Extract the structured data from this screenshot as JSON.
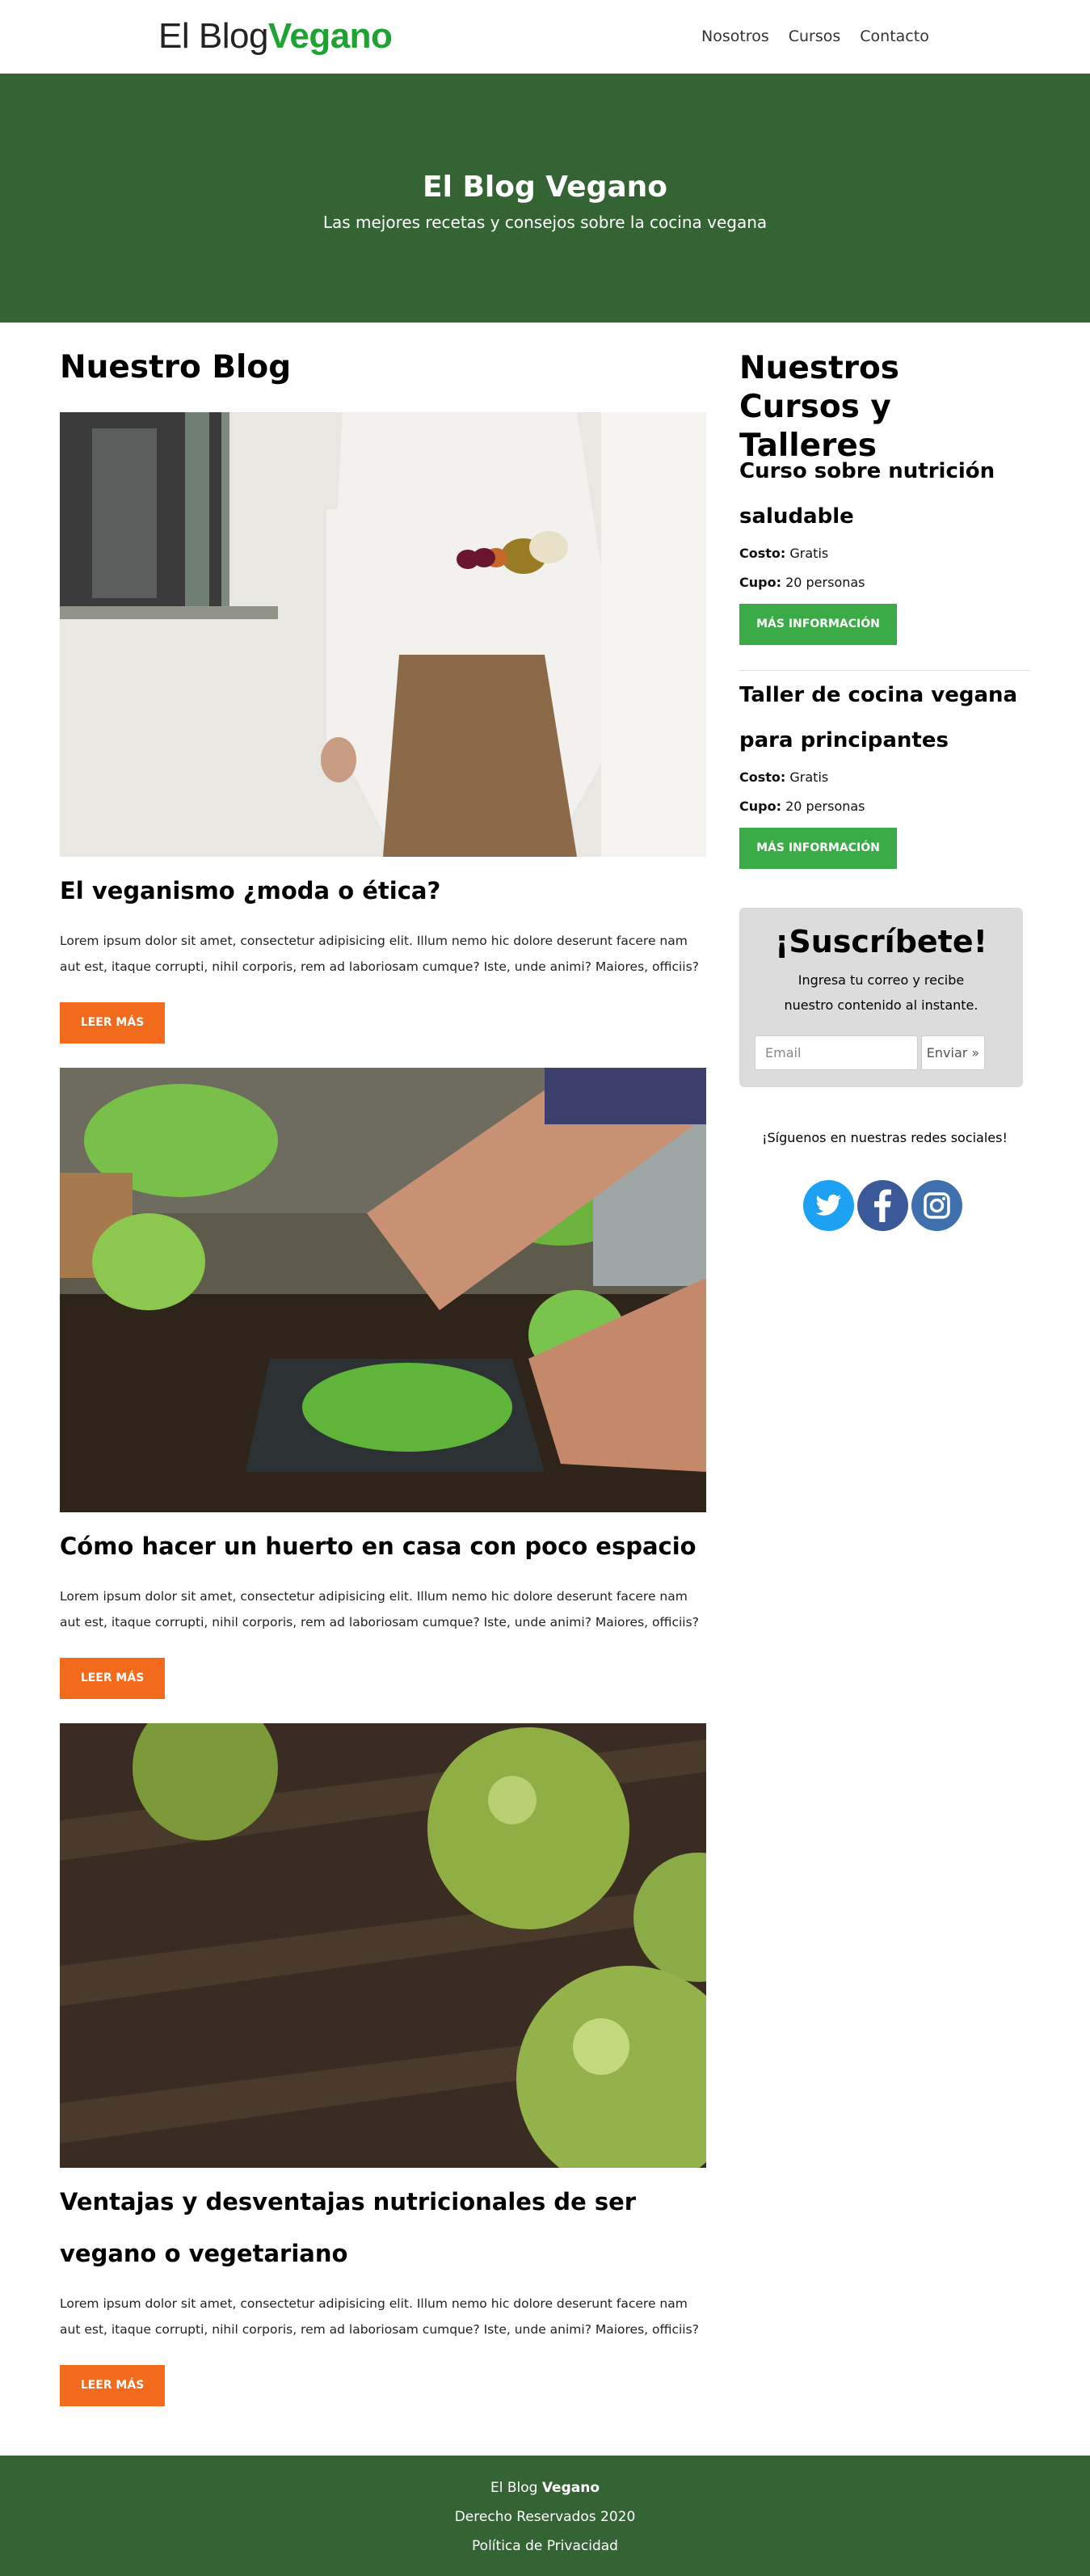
{
  "header": {
    "logo_plain": "El Blog",
    "logo_accent": "Vegano",
    "nav": [
      "Nosotros",
      "Cursos",
      "Contacto"
    ]
  },
  "hero": {
    "title": "El Blog Vegano",
    "subtitle": "Las mejores recetas y consejos sobre la cocina vegana"
  },
  "blog": {
    "title": "Nuestro Blog",
    "posts": [
      {
        "title": "El veganismo ¿moda o ética?",
        "excerpt": "Lorem ipsum dolor sit amet, consectetur adipisicing elit. Illum nemo hic dolore deserunt facere nam aut est, itaque corrupti, nihil corporis, rem ad laboriosam cumque? Iste, unde animi? Maiores, officiis?",
        "button": "LEER MÁS"
      },
      {
        "title": "Cómo hacer un huerto en casa con poco espacio",
        "excerpt": "Lorem ipsum dolor sit amet, consectetur adipisicing elit. Illum nemo hic dolore deserunt facere nam aut est, itaque corrupti, nihil corporis, rem ad laboriosam cumque? Iste, unde animi? Maiores, officiis?",
        "button": "LEER MÁS"
      },
      {
        "title": "Ventajas y desventajas nutricionales de ser vegano o vegetariano",
        "excerpt": "Lorem ipsum dolor sit amet, consectetur adipisicing elit. Illum nemo hic dolore deserunt facere nam aut est, itaque corrupti, nihil corporis, rem ad laboriosam cumque? Iste, unde animi? Maiores, officiis?",
        "button": "LEER MÁS"
      }
    ]
  },
  "courses": {
    "title": "Nuestros Cursos y Talleres",
    "items": [
      {
        "name": "Curso sobre nutrición saludable",
        "cost_label": "Costo:",
        "cost": "Gratis",
        "capacity_label": "Cupo:",
        "capacity": "20 personas",
        "button": "MÁS INFORMACIÓN"
      },
      {
        "name": "Taller de cocina vegana para principantes",
        "cost_label": "Costo:",
        "cost": "Gratis",
        "capacity_label": "Cupo:",
        "capacity": "20 personas",
        "button": "MÁS INFORMACIÓN"
      }
    ]
  },
  "subscribe": {
    "title": "¡Suscríbete!",
    "text": "Ingresa tu correo y recibe nuestro contenido al instante.",
    "placeholder": "Email",
    "button": "Enviar »"
  },
  "social": {
    "text": "¡Síguenos en nuestras redes sociales!",
    "icons": [
      "twitter-icon",
      "facebook-icon",
      "instagram-icon"
    ]
  },
  "footer": {
    "brand_plain": "El Blog",
    "brand_bold": "Vegano",
    "rights": "Derecho Reservados 2020",
    "privacy": "Política de Privacidad"
  },
  "colors": {
    "green_dark": "#346434",
    "green_logo": "#1ea232",
    "orange_button": "#f26a1b",
    "green_button": "#3aab47",
    "twitter_blue": "#1da1f2",
    "facebook_blue": "#3b5998",
    "instagram_blue": "#3f6fad"
  }
}
